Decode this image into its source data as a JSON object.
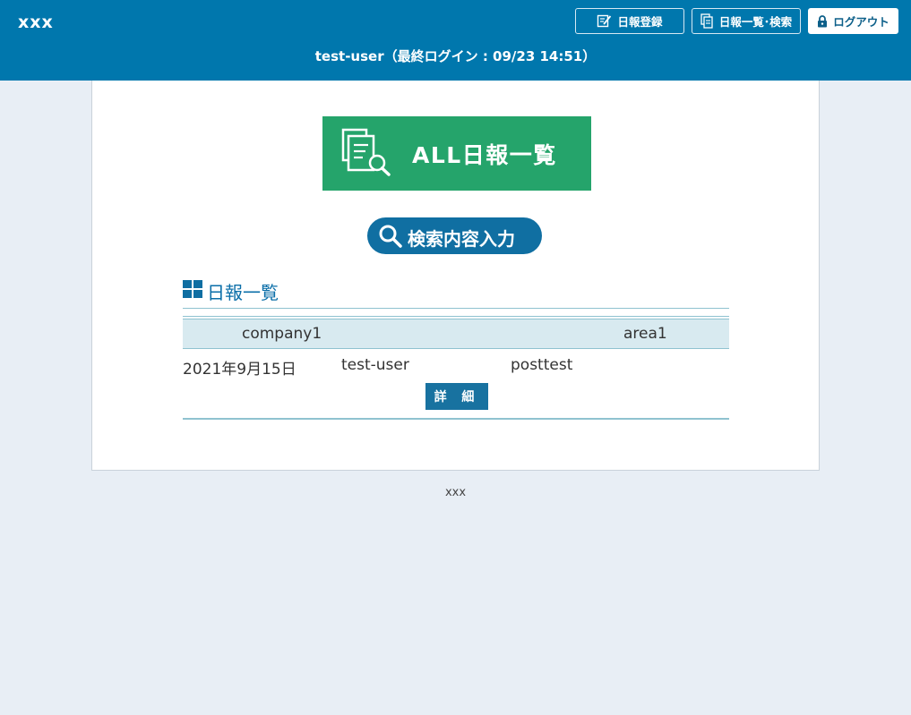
{
  "header": {
    "app_title": "xxx",
    "buttons": {
      "register": "日報登録",
      "list_search": "日報一覧･検索",
      "logout": "ログアウト"
    },
    "login_info": "test-user（最終ログイン : 09/23 14:51）"
  },
  "main": {
    "all_reports_button": "ALL日報一覧",
    "search_button": "検索内容入力",
    "section_title": "日報一覧",
    "report": {
      "company": "company1",
      "area": "area1",
      "date": "2021年9月15日",
      "user": "test-user",
      "title": "posttest",
      "detail_button": "詳 細"
    }
  },
  "footer": {
    "text": "xxx"
  },
  "colors": {
    "header_bg": "#0077ad",
    "green_button": "#25a46b",
    "blue_button": "#106fa2",
    "row_header_bg": "#d8eaf0"
  },
  "icons": [
    "edit-icon",
    "document-list-icon",
    "lock-icon",
    "document-search-icon",
    "magnifier-icon",
    "grid-icon"
  ]
}
